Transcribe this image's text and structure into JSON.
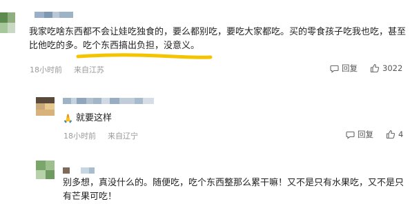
{
  "comments": [
    {
      "text_line1": "我家吃啥东西都不会让娃吃独食的，要么都别吃，要吃大家都吃。买的零食孩子吃我也吃，甚至",
      "text_line2": "比他吃的多。吃个东西搞出负担，没意义。",
      "time": "18小时前",
      "location": "来自江苏",
      "reply_label": "回复",
      "like_count": "3022"
    },
    {
      "emoji": "🙏",
      "text": "就要这样",
      "time": "18小时前",
      "location": "来自辽宁",
      "reply_label": "回复",
      "like_count": "4"
    },
    {
      "text_line1": "别多想，真没什么的。随便吃，吃个东西整那么累干嘛！又不是只有水果吃，又不是只",
      "text_line2": "有芒果可吃！"
    }
  ],
  "icons": {
    "reply": "comment-bubble-icon",
    "like": "thumbs-up-icon",
    "underline": "yellow-highlight-stroke"
  },
  "colors": {
    "text": "#222222",
    "meta": "#9a9a9a",
    "highlight": "#f5c400"
  }
}
